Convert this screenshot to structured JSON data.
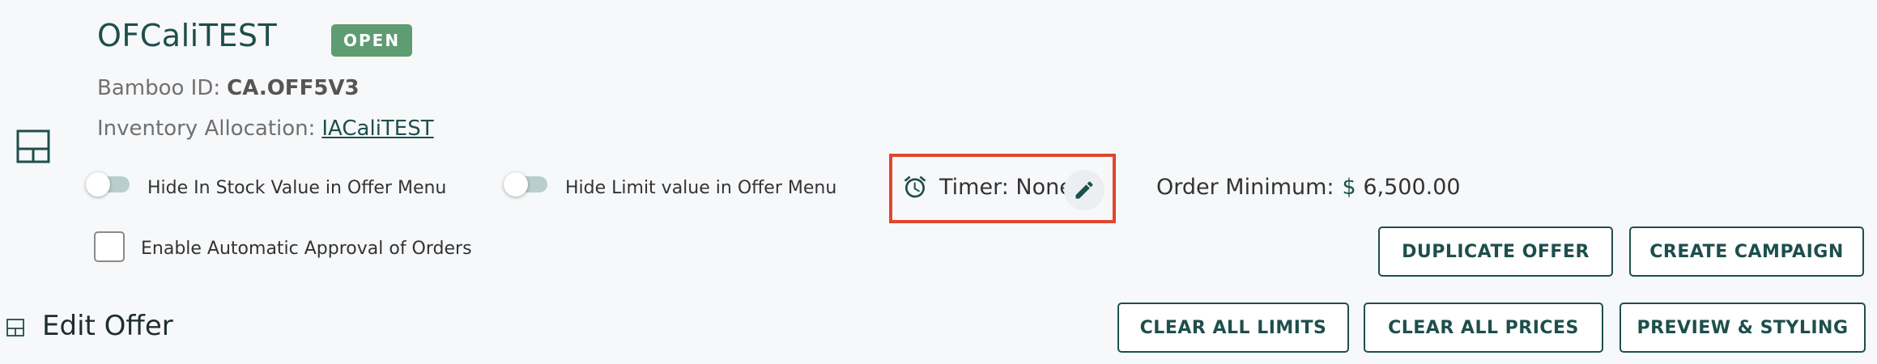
{
  "offer": {
    "name": "OFCaliTEST",
    "status": "OPEN",
    "bamboo_label": "Bamboo ID:",
    "bamboo_value": "CA.OFF5V3",
    "inventory_label": "Inventory Allocation:",
    "inventory_value": "IACaliTEST"
  },
  "options": {
    "hide_in_stock": "Hide In Stock Value in Offer Menu",
    "hide_limit": "Hide Limit value in Offer Menu",
    "auto_approval": "Enable Automatic Approval of Orders"
  },
  "timer": {
    "label": "Timer: None"
  },
  "order_minimum": {
    "label": "Order Minimum:",
    "currency": "$",
    "value": "6,500.00"
  },
  "actions": {
    "duplicate_offer": "DUPLICATE OFFER",
    "create_campaign": "CREATE CAMPAIGN",
    "clear_all_limits": "CLEAR ALL LIMITS",
    "clear_all_prices": "CLEAR ALL PRICES",
    "preview_styling": "PREVIEW & STYLING"
  },
  "section": {
    "title": "Edit Offer"
  },
  "icons": {
    "layout": "layout-icon",
    "alarm": "alarm-clock-icon",
    "edit": "pencil-icon"
  },
  "colors": {
    "brand": "#1d4f4c",
    "status": "#5e9c72",
    "highlight": "#e0462e"
  }
}
